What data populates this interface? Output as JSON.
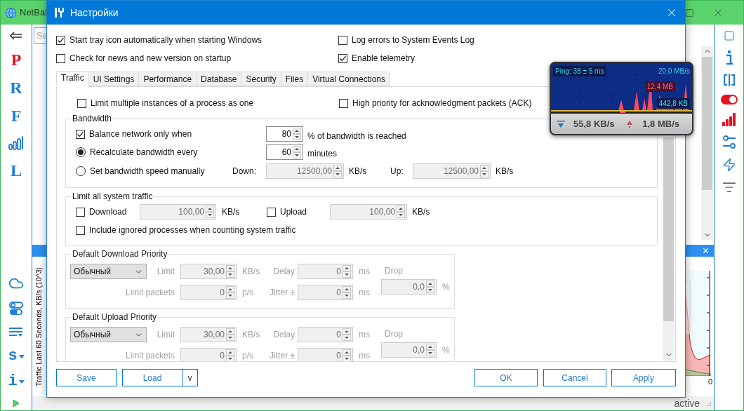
{
  "app": {
    "title": "NetBal",
    "search_placeholder": "Se",
    "left_nav": [
      {
        "label": "P",
        "color": "#e81123"
      },
      {
        "label": "R",
        "color": "#1e7fd8"
      },
      {
        "label": "F",
        "color": "#1e7fd8"
      },
      {
        "label": "L",
        "color": "#1e7fd8"
      }
    ],
    "left_menus": [
      "s",
      "i"
    ],
    "chart_label": "Traffic Last 60 Seconds, KB/s (10^3)",
    "chart_axis_label": "0",
    "status": "active"
  },
  "dialog": {
    "title": "Настройки",
    "general_options": [
      {
        "label": "Start tray icon automatically when starting Windows",
        "checked": true
      },
      {
        "label": "Log errors to System Events Log",
        "checked": false
      },
      {
        "label": "Check for news and new version on startup",
        "checked": false
      },
      {
        "label": "Enable telemetry",
        "checked": true
      }
    ],
    "tabs": [
      {
        "label": "Traffic",
        "selected": true
      },
      {
        "label": "UI Settings",
        "selected": false
      },
      {
        "label": "Performance",
        "selected": false
      },
      {
        "label": "Database",
        "selected": false
      },
      {
        "label": "Security",
        "selected": false
      },
      {
        "label": "Files",
        "selected": false
      },
      {
        "label": "Virtual Connections",
        "selected": false
      }
    ],
    "traffic": {
      "options": [
        {
          "label": "Limit multiple instances of a process as one",
          "checked": false
        },
        {
          "label": "High priority for acknowledgment packets (ACK)",
          "checked": false
        }
      ],
      "bandwidth": {
        "title": "Bandwidth",
        "balance": {
          "label": "Balance network only when",
          "checked": true,
          "field": {
            "value": "80",
            "disabled": false
          },
          "suffix": "% of bandwidth is reached"
        },
        "recalc": {
          "label": "Recalculate bandwidth every",
          "selected": true,
          "field": {
            "value": "60",
            "disabled": false
          },
          "suffix": "minutes"
        },
        "manual": {
          "label": "Set bandwidth speed manually",
          "selected": false,
          "down_label": "Down:",
          "down": {
            "value": "12500,00",
            "disabled": true
          },
          "down_unit": "KB/s",
          "up_label": "Up:",
          "up": {
            "value": "12500,00",
            "disabled": true
          },
          "up_unit": "KB/s"
        }
      },
      "system_limit": {
        "title": "Limit all system traffic",
        "download": {
          "label": "Download",
          "checked": false,
          "field": {
            "value": "100,00",
            "disabled": true
          },
          "unit": "KB/s"
        },
        "upload": {
          "label": "Upload",
          "checked": false,
          "field": {
            "value": "100,00",
            "disabled": true
          },
          "unit": "KB/s"
        },
        "include": {
          "label": "Include ignored processes when counting system traffic",
          "checked": false
        }
      },
      "priorities": [
        {
          "title": "Default Download Priority",
          "mode": "Обычный",
          "disabled": true,
          "limit_label": "Limit",
          "limit": "30,00",
          "limit_unit": "KB/s",
          "delay_label": "Delay",
          "delay": "0",
          "delay_unit": "ms",
          "packets_label": "Limit packets",
          "packets": "0",
          "packets_unit": "p/s",
          "jitter_label": "Jitter ±",
          "jitter": "0",
          "jitter_unit": "ms",
          "drop_label": "Drop",
          "drop": "0,0",
          "drop_unit": "%"
        },
        {
          "title": "Default Upload Priority",
          "mode": "Обычный",
          "disabled": true,
          "limit_label": "Limit",
          "limit": "30,00",
          "limit_unit": "KB/s",
          "delay_label": "Delay",
          "delay": "0",
          "delay_unit": "ms",
          "packets_label": "Limit packets",
          "packets": "0",
          "packets_unit": "p/s",
          "jitter_label": "Jitter ±",
          "jitter": "0",
          "jitter_unit": "ms",
          "drop_label": "Drop",
          "drop": "0,0",
          "drop_unit": "%"
        }
      ]
    },
    "buttons": {
      "save": "Save",
      "load": "Load",
      "load_menu": "v",
      "ok": "OK",
      "cancel": "Cancel",
      "apply": "Apply"
    }
  },
  "widget": {
    "ping": "Ping: 38 ± 5 ms",
    "max": "20,0 MB/s",
    "peak": "12,4 MB",
    "current": "442,8 KB",
    "down": "55,8 KB/s",
    "up": "1,8 MB/s"
  }
}
